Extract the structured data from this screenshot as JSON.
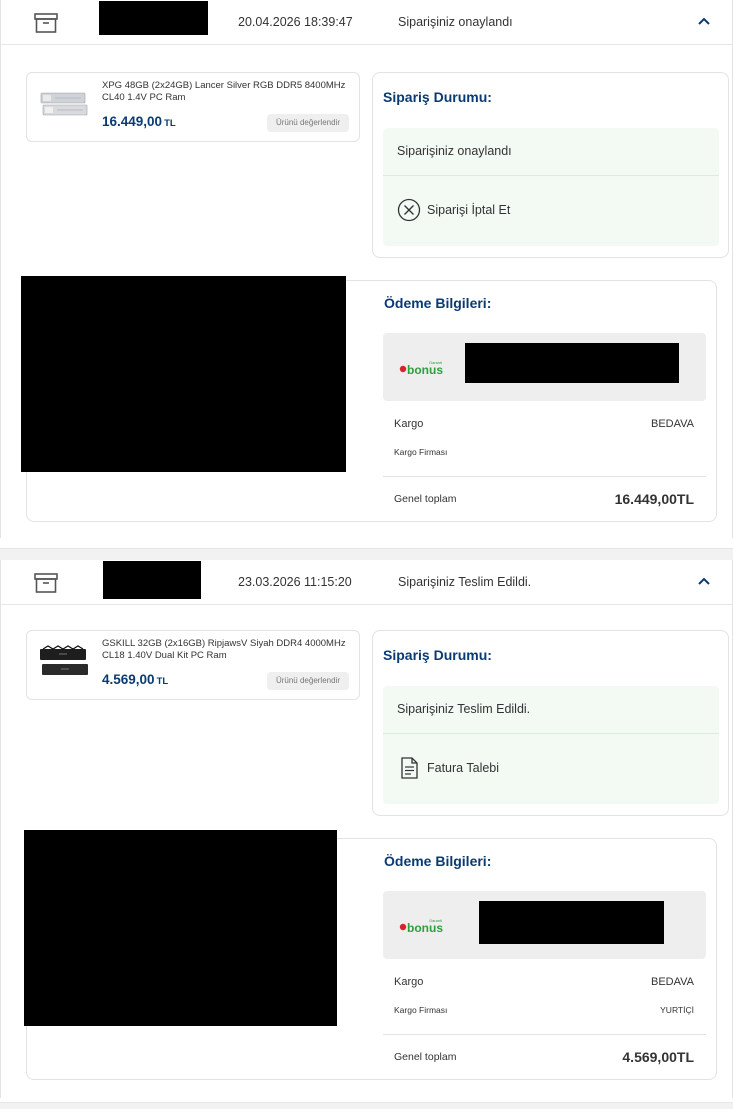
{
  "orders": [
    {
      "date": "20.04.2026 18:39:47",
      "status": "Siparişiniz onaylandı",
      "product": {
        "name": "XPG 48GB (2x24GB) Lancer Silver RGB DDR5 8400MHz CL40 1.4V PC Ram",
        "price": "16.449,00",
        "currency": "TL",
        "rate_button": "Ürünü değerlendir"
      },
      "status_card": {
        "title": "Sipariş Durumu:",
        "current": "Siparişiniz onaylandı",
        "action_label": "Siparişi İptal Et",
        "action_icon": "cancel-circle-icon"
      },
      "payment": {
        "title": "Ödeme Bilgileri:",
        "card_logo": "bonus",
        "card_logo_small": "Garanti",
        "shipping_label": "Kargo",
        "shipping_value": "BEDAVA",
        "carrier_label": "Kargo Firması",
        "carrier_value": "",
        "total_label": "Genel toplam",
        "total_value": "16.449,00TL"
      }
    },
    {
      "date": "23.03.2026 11:15:20",
      "status": "Siparişiniz Teslim Edildi.",
      "product": {
        "name": "GSKILL 32GB (2x16GB) RipjawsV Siyah DDR4 4000MHz CL18 1.40V Dual Kit PC Ram",
        "price": "4.569,00",
        "currency": "TL",
        "rate_button": "Ürünü değerlendir"
      },
      "status_card": {
        "title": "Sipariş Durumu:",
        "current": "Siparişiniz Teslim Edildi.",
        "action_label": "Fatura Talebi",
        "action_icon": "invoice-document-icon"
      },
      "payment": {
        "title": "Ödeme Bilgileri:",
        "card_logo": "bonus",
        "card_logo_small": "Garanti",
        "shipping_label": "Kargo",
        "shipping_value": "BEDAVA",
        "carrier_label": "Kargo Firması",
        "carrier_value": "YURTİÇİ",
        "total_label": "Genel toplam",
        "total_value": "4.569,00TL"
      }
    }
  ],
  "colors": {
    "accent": "#0b3a73",
    "status_bg": "#f3faf3",
    "bonus_green": "#2e9e3e",
    "bonus_red": "#d8232a"
  }
}
